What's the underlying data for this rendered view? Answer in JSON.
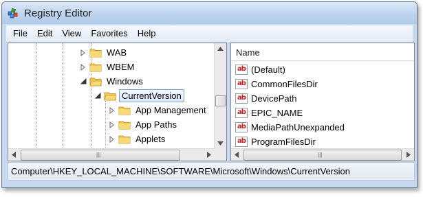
{
  "window": {
    "title": "Registry Editor"
  },
  "menu": [
    "File",
    "Edit",
    "View",
    "Favorites",
    "Help"
  ],
  "tree": {
    "nodes": [
      {
        "label": "WAB",
        "state": "collapsed"
      },
      {
        "label": "WBEM",
        "state": "collapsed"
      },
      {
        "label": "Windows",
        "state": "expanded"
      },
      {
        "label": "CurrentVersion",
        "state": "expanded",
        "selected": true
      },
      {
        "label": "App Management",
        "state": "collapsed"
      },
      {
        "label": "App Paths",
        "state": "collapsed"
      },
      {
        "label": "Applets",
        "state": "collapsed"
      }
    ]
  },
  "values": {
    "column_header": "Name",
    "rows": [
      {
        "name": "(Default)",
        "icon": "string-value-icon"
      },
      {
        "name": "CommonFilesDir",
        "icon": "string-value-icon"
      },
      {
        "name": "DevicePath",
        "icon": "string-value-icon"
      },
      {
        "name": "EPIC_NAME",
        "icon": "string-value-icon"
      },
      {
        "name": "MediaPathUnexpanded",
        "icon": "string-value-icon"
      },
      {
        "name": "ProgramFilesDir",
        "icon": "string-value-icon"
      }
    ]
  },
  "status": {
    "path": "Computer\\HKEY_LOCAL_MACHINE\\SOFTWARE\\Microsoft\\Windows\\CurrentVersion"
  },
  "colors": {
    "titlebar": "#bcd2ee",
    "folder": "#f3c85a",
    "selection": "#dbe8f9",
    "string_icon_text": "#c42020"
  }
}
